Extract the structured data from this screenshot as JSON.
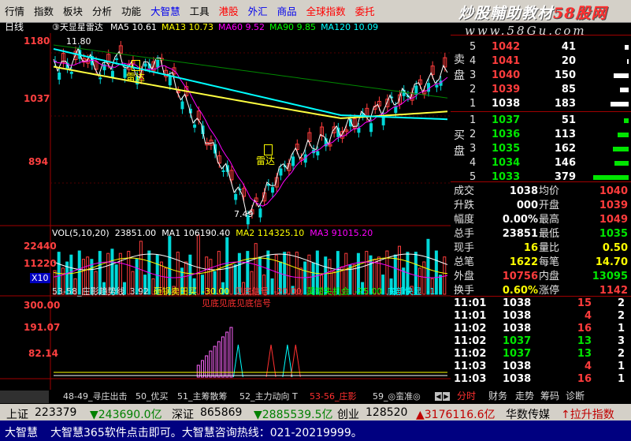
{
  "menu": [
    {
      "label": "行情",
      "color": "black"
    },
    {
      "label": "指数",
      "color": "black"
    },
    {
      "label": "板块",
      "color": "black"
    },
    {
      "label": "分析",
      "color": "black"
    },
    {
      "label": "功能",
      "color": "black"
    },
    {
      "label": "大智慧",
      "color": "blue"
    },
    {
      "label": "工具",
      "color": "black"
    },
    {
      "label": "港股",
      "color": "red"
    },
    {
      "label": "外汇",
      "color": "blue"
    },
    {
      "label": "商品",
      "color": "blue"
    },
    {
      "label": "全球指数",
      "color": "red"
    },
    {
      "label": "委托",
      "color": "red"
    }
  ],
  "brand": {
    "text_a": "炒股輔助教材",
    "text_b": "58股网",
    "site": "www.58Gu.com"
  },
  "chart": {
    "period": "日线",
    "stock_name": "③天显星雷达",
    "ma": [
      {
        "label": "MA5",
        "value": "10.61",
        "color": "#ffffff"
      },
      {
        "label": "MA13",
        "value": "10.73",
        "color": "#ffff00"
      },
      {
        "label": "MA60",
        "value": "9.52",
        "color": "#ff00ff"
      },
      {
        "label": "MA90",
        "value": "9.85",
        "color": "#00ff00"
      },
      {
        "label": "MA120",
        "value": "10.09",
        "color": "#00ffff"
      }
    ],
    "price_axis": [
      "1180",
      "1037",
      "894"
    ],
    "high_mark": "11.80",
    "low_mark": "7.49",
    "signal_labels": [
      "雷达",
      "雷达"
    ],
    "vol_header": {
      "label": "VOL(5,10,20)",
      "v": "23851.00",
      "ma1_label": "MA1",
      "ma1": "106190.40",
      "ma2_label": "MA2",
      "ma2": "114325.10",
      "ma3_label": "MA3",
      "ma3": "91015.20"
    },
    "vol_axis": [
      "22440",
      "11220"
    ],
    "vol_unit": "X10",
    "ind_header": [
      {
        "text": "53-58_庄影趋势线",
        "color": "#dddddd"
      },
      {
        "text": "3.92",
        "color": "#dddddd"
      },
      {
        "text": "砸锅卖田买",
        "color": "#ffff00"
      },
      {
        "text": "-30.00",
        "color": "#ffff00"
      },
      {
        "text": "见底信号",
        "color": "#ff4040"
      },
      {
        "text": "-20.00",
        "color": "#ff4040"
      },
      {
        "text": "莫错失机会",
        "color": "#00ff00"
      },
      {
        "text": "-25.00",
        "color": "#00ff00"
      },
      {
        "text": "底部快显",
        "color": "#00ffff"
      },
      {
        "text": "-1",
        "color": "#00ffff"
      }
    ],
    "ind_axis": [
      "300.00",
      "191.07",
      "82.14"
    ],
    "ind_overlay": [
      "见底",
      "见底",
      "见底信号"
    ]
  },
  "quote": {
    "sell_label": "卖盘",
    "buy_label": "买盘",
    "asks": [
      {
        "lvl": "5",
        "price": "1042",
        "vol": "41"
      },
      {
        "lvl": "4",
        "price": "1041",
        "vol": "20"
      },
      {
        "lvl": "3",
        "price": "1040",
        "vol": "150"
      },
      {
        "lvl": "2",
        "price": "1039",
        "vol": "85"
      },
      {
        "lvl": "1",
        "price": "1038",
        "vol": "183"
      }
    ],
    "bids": [
      {
        "lvl": "1",
        "price": "1037",
        "vol": "51"
      },
      {
        "lvl": "2",
        "price": "1036",
        "vol": "113"
      },
      {
        "lvl": "3",
        "price": "1035",
        "vol": "162"
      },
      {
        "lvl": "4",
        "price": "1034",
        "vol": "146"
      },
      {
        "lvl": "5",
        "price": "1033",
        "vol": "379"
      }
    ],
    "stats": [
      {
        "l1": "成交",
        "v1": "1038",
        "c1": "w",
        "l2": "均价",
        "v2": "1040",
        "c2": "r"
      },
      {
        "l1": "升跌",
        "v1": "000",
        "c1": "w",
        "l2": "开盘",
        "v2": "1039",
        "c2": "r"
      },
      {
        "l1": "幅度",
        "v1": "0.00%",
        "c1": "w",
        "l2": "最高",
        "v2": "1049",
        "c2": "r"
      },
      {
        "l1": "总手",
        "v1": "23851",
        "c1": "w",
        "l2": "最低",
        "v2": "1035",
        "c2": "g"
      },
      {
        "l1": "现手",
        "v1": "16",
        "c1": "y",
        "l2": "量比",
        "v2": "0.50",
        "c2": "y"
      },
      {
        "l1": "总笔",
        "v1": "1622",
        "c1": "y",
        "l2": "每笔",
        "v2": "14.70",
        "c2": "y"
      },
      {
        "l1": "外盘",
        "v1": "10756",
        "c1": "r",
        "l2": "内盘",
        "v2": "13095",
        "c2": "g"
      },
      {
        "l1": "换手",
        "v1": "0.60%",
        "c1": "y",
        "l2": "涨停",
        "v2": "1142",
        "c2": "r"
      }
    ],
    "ticks": [
      {
        "t": "11:01",
        "p": "1038",
        "pc": "w",
        "v": "15",
        "vc": "r",
        "n": "2"
      },
      {
        "t": "11:01",
        "p": "1038",
        "pc": "w",
        "v": "4",
        "vc": "r",
        "n": "2"
      },
      {
        "t": "11:02",
        "p": "1038",
        "pc": "w",
        "v": "16",
        "vc": "r",
        "n": "1"
      },
      {
        "t": "11:02",
        "p": "1037",
        "pc": "g",
        "v": "13",
        "vc": "g",
        "n": "3"
      },
      {
        "t": "11:02",
        "p": "1037",
        "pc": "g",
        "v": "13",
        "vc": "g",
        "n": "2"
      },
      {
        "t": "11:03",
        "p": "1038",
        "pc": "w",
        "v": "4",
        "vc": "r",
        "n": "1"
      },
      {
        "t": "11:03",
        "p": "1038",
        "pc": "w",
        "v": "16",
        "vc": "r",
        "n": "1"
      }
    ]
  },
  "indicator_tabs": [
    "48-49_寻庄出击",
    "50_优买",
    "51_主筹散筹",
    "52_主力动向 T",
    "53-56_庄影",
    "59_◎蛮准◎"
  ],
  "side_tabs": [
    "分时",
    "财务",
    "走势",
    "筹码",
    "诊断"
  ],
  "status": {
    "sh_label": "上证",
    "sh_val": "223379",
    "sh_chg": "▼243690.0亿",
    "sz_label": "深证",
    "sz_val": "865869",
    "sz_chg": "▼2885539.5亿",
    "cy_label": "创业",
    "cy_val": "128520",
    "cy_chg": "▲3176116.6亿",
    "news": "华数传媒",
    "news2": "↑拉升指数"
  },
  "ticker": {
    "app": "大智慧",
    "text": "大智慧365软件点击即可。大智慧咨询热线：021-20219999。"
  }
}
